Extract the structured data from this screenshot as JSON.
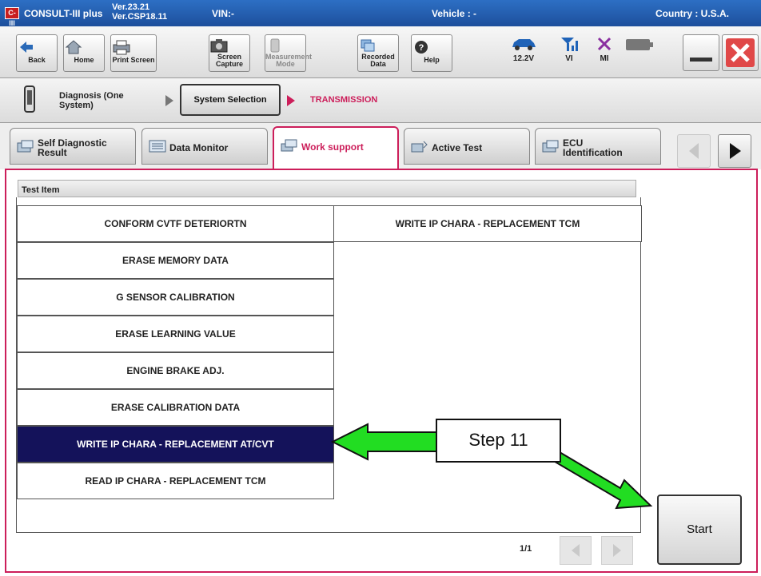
{
  "titlebar": {
    "logo": "C-III",
    "app_name": "CONSULT-III plus",
    "version_1": "Ver.23.21",
    "version_2": "Ver.CSP18.11",
    "vin": "VIN:-",
    "vehicle": "Vehicle : -",
    "country": "Country : U.S.A."
  },
  "toolbar": {
    "back": "Back",
    "home": "Home",
    "print_screen": "Print Screen",
    "screen_capture_1": "Screen",
    "screen_capture_2": "Capture",
    "measurement_1": "Measurement",
    "measurement_2": "Mode",
    "recorded_1": "Recorded",
    "recorded_2": "Data",
    "help": "Help",
    "voltage": "12.2V",
    "vi": "VI",
    "mi": "MI"
  },
  "breadcrumb": {
    "diagnosis_1": "Diagnosis (One",
    "diagnosis_2": "System)",
    "system_selection": "System Selection",
    "current": "TRANSMISSION"
  },
  "tabs": {
    "self_diag_1": "Self Diagnostic",
    "self_diag_2": "Result",
    "data_monitor": "Data Monitor",
    "work_support": "Work support",
    "active_test": "Active Test",
    "ecu_1": "ECU",
    "ecu_2": "Identification"
  },
  "list": {
    "header": "Test Item",
    "items": [
      "CONFORM CVTF DETERIORTN",
      "ERASE MEMORY DATA",
      "G SENSOR CALIBRATION",
      "ERASE LEARNING VALUE",
      "ENGINE BRAKE ADJ.",
      "ERASE CALIBRATION DATA",
      "WRITE IP CHARA - REPLACEMENT AT/CVT",
      "READ IP CHARA - REPLACEMENT TCM",
      "WRITE IP CHARA - REPLACEMENT TCM"
    ],
    "selected_index": 6,
    "page": "1/1"
  },
  "start_label": "Start",
  "annotation": {
    "step": "Step 11",
    "arrow_color": "#22dd22"
  },
  "colors": {
    "titlebar": "#1d4f9c",
    "accent": "#cc1e5a",
    "selected_row": "#14125a"
  }
}
